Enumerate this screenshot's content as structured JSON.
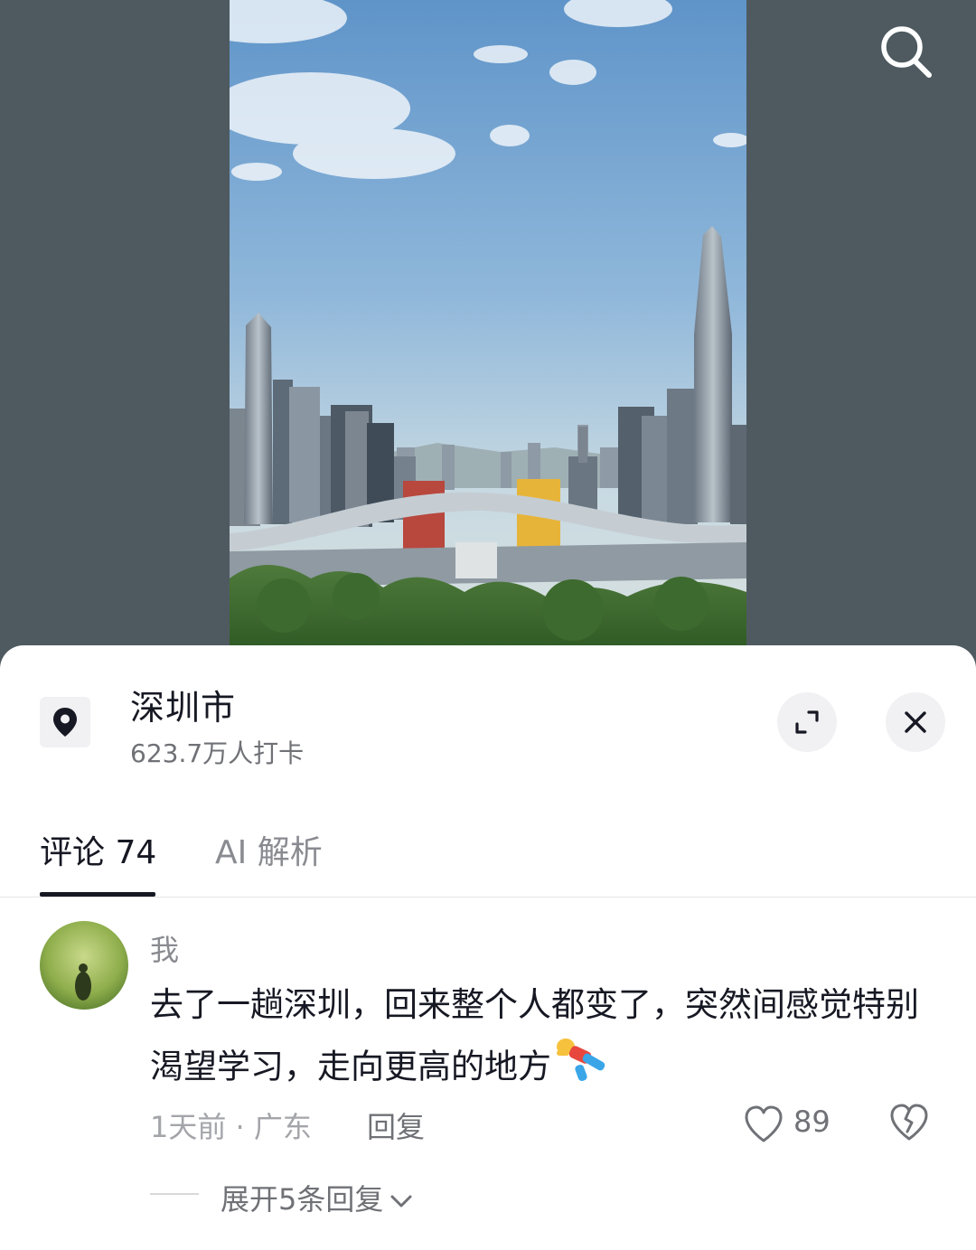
{
  "header": {
    "search_icon": "search-icon"
  },
  "location": {
    "title": "深圳市",
    "checkins": "623.7万人打卡",
    "pin_icon": "location-pin-icon",
    "expand_icon": "expand-icon",
    "close_icon": "close-icon"
  },
  "tabs": [
    {
      "label": "评论 74",
      "active": true
    },
    {
      "label": "AI 解析",
      "active": false
    }
  ],
  "comment": {
    "username": "我",
    "text": "去了一趟深圳，回来整个人都变了，突然间感觉特别渴望学习，走向更高的地方",
    "emoji_icon": "flying-person-emoji-icon",
    "time": "1天前",
    "location": "广东",
    "separator": " · ",
    "reply_label": "回复",
    "like_count": "89",
    "like_icon": "heart-icon",
    "dislike_icon": "broken-heart-icon",
    "expand_replies": "展开5条回复"
  },
  "colors": {
    "background": "#4e5a60",
    "sheet": "#ffffff",
    "primary_text": "#161823",
    "secondary_text": "#8a8b91"
  }
}
